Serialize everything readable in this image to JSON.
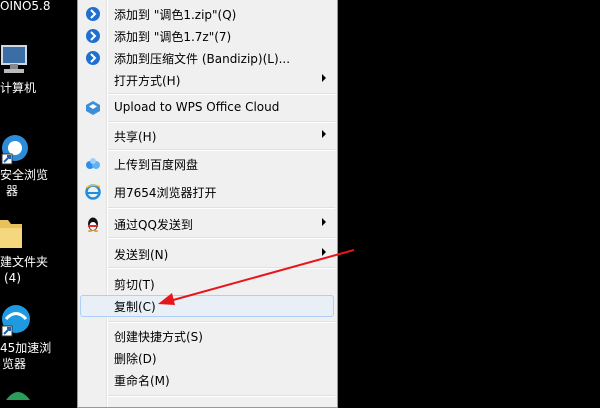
{
  "desktop": {
    "top_partial": "OINO5.8",
    "computer": "计算机",
    "browser1_line1": "安全浏览",
    "browser1_line2": "器",
    "folder_line1": "建文件夹",
    "folder_line2": "(4)",
    "browser2_line1": "45加速浏",
    "browser2_line2": "览器"
  },
  "menu": {
    "items": [
      {
        "label": "添加到 \"调色1.zip\"(Q)",
        "icon": "bandizip-icon"
      },
      {
        "label": "添加到 \"调色1.7z\"(7)",
        "icon": "bandizip-icon"
      },
      {
        "label": "添加到压缩文件 (Bandizip)(L)...",
        "icon": "bandizip-icon"
      },
      {
        "label": "打开方式(H)",
        "submenu": true
      },
      {
        "label": "Upload to WPS Office Cloud",
        "icon": "wps-cloud-icon"
      },
      {
        "label": "共享(H)",
        "submenu": true
      },
      {
        "label": "上传到百度网盘",
        "icon": "baidu-netdisk-icon"
      },
      {
        "label": "用7654浏览器打开",
        "icon": "ie-browser-icon"
      },
      {
        "label": "通过QQ发送到",
        "icon": "qq-icon",
        "submenu": true
      },
      {
        "label": "发送到(N)",
        "submenu": true
      },
      {
        "label": "剪切(T)"
      },
      {
        "label": "复制(C)",
        "highlighted": true
      },
      {
        "label": "创建快捷方式(S)"
      },
      {
        "label": "删除(D)"
      },
      {
        "label": "重命名(M)"
      }
    ]
  },
  "colors": {
    "menu_bg": "#f0f0f0",
    "highlight_bg": "#e8eff7",
    "highlight_border": "#aecff7",
    "annotation_arrow": "#e8141c"
  }
}
